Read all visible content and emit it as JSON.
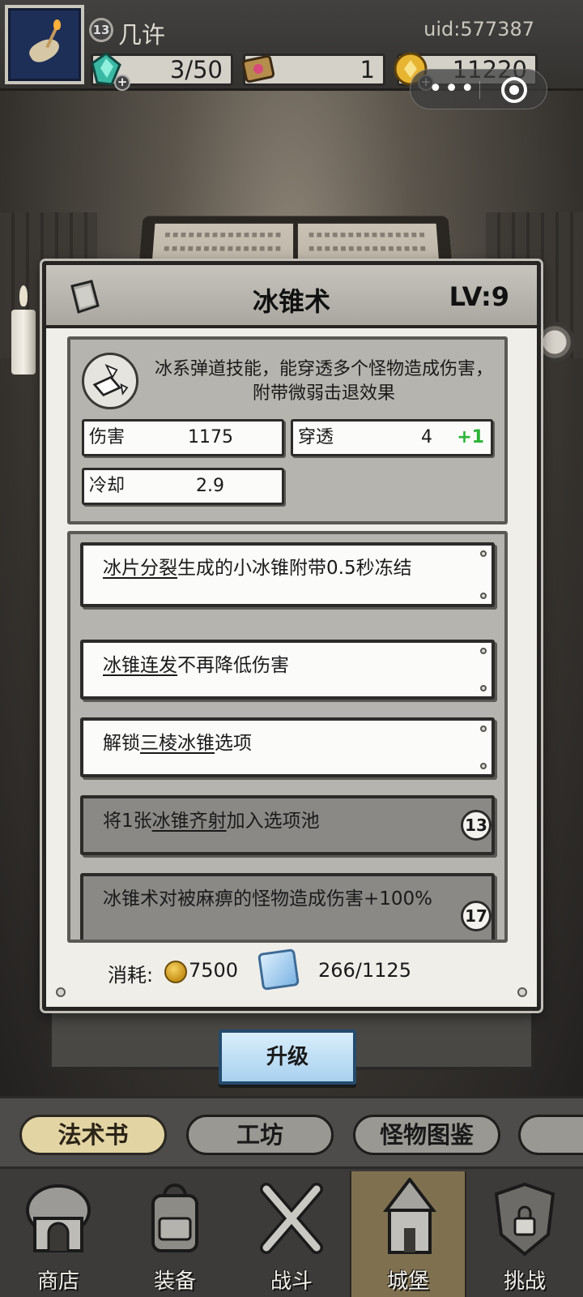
{
  "player": {
    "level": "13",
    "name": "几许",
    "uid": "uid:577387"
  },
  "resources": {
    "energy": "3/50",
    "tickets": "1",
    "gold": "11220"
  },
  "capsule": {
    "more": "•••"
  },
  "modal": {
    "title": "冰锥术",
    "level": "LV:9",
    "description": "冰系弹道技能，能穿透多个怪物造成伤害，附带微弱击退效果",
    "stats": [
      {
        "key": "伤害",
        "value": "1175",
        "bonus": ""
      },
      {
        "key": "穿透",
        "value": "4",
        "bonus": "+1"
      },
      {
        "key": "冷却",
        "value": "2.9",
        "bonus": ""
      }
    ],
    "perks": [
      {
        "keyword": "冰片分裂",
        "prefix": "",
        "suffix": "生成的小冰锥附带0.5秒冻结",
        "locked": false,
        "lock_level": ""
      },
      {
        "keyword": "冰锥连发",
        "prefix": "",
        "suffix": "不再降低伤害",
        "locked": false,
        "lock_level": ""
      },
      {
        "keyword": "三棱冰锥",
        "prefix": "解锁",
        "suffix": "选项",
        "locked": false,
        "lock_level": ""
      },
      {
        "keyword": "冰锥齐射",
        "prefix": "将1张",
        "suffix": "加入选项池",
        "locked": true,
        "lock_level": "13"
      },
      {
        "keyword": "",
        "prefix": "冰锥术对被麻痹的怪物造成伤害+100%",
        "suffix": "",
        "locked": true,
        "lock_level": "17"
      }
    ],
    "cost_label": "消耗:",
    "cost_gold": "7500",
    "cost_fragments": "266/1125",
    "upgrade_label": "升级"
  },
  "subtabs": [
    "法术书",
    "工坊",
    "怪物图鉴"
  ],
  "nav": [
    "商店",
    "装备",
    "战斗",
    "城堡",
    "挑战"
  ],
  "colors": {
    "bonus": "#2db338",
    "active_tab": "#e3d4a3",
    "upgrade_button": "#a8d1ef"
  }
}
